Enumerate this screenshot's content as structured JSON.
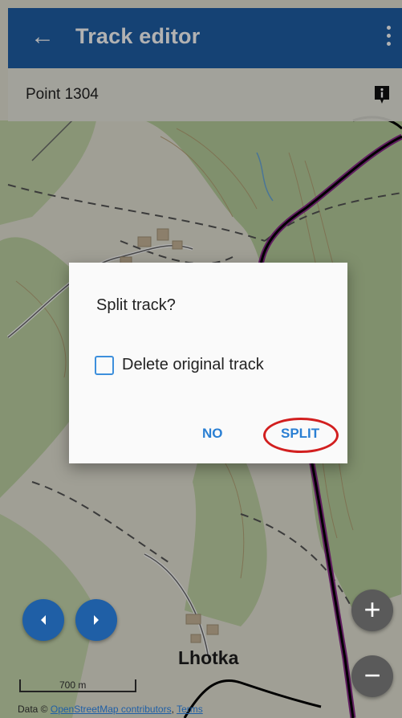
{
  "appbar": {
    "title": "Track editor",
    "back_icon": "arrow-left-icon",
    "menu_icon": "more-vert-icon"
  },
  "infobar": {
    "point_label": "Point 1304",
    "info_icon": "info-icon"
  },
  "dialog": {
    "title": "Split track?",
    "checkbox_label": "Delete original track",
    "checkbox_checked": false,
    "no_label": "NO",
    "split_label": "SPLIT"
  },
  "map": {
    "place_label": "Lhotka",
    "scale_label": "700 m",
    "attribution": {
      "prefix": "Data © ",
      "osm": "OpenStreetMap contributors",
      "sep": ", ",
      "terms": "Terms"
    }
  },
  "colors": {
    "appbar": "#1f5fa6",
    "accent": "#2a7fd3",
    "highlight_ring": "#d21f1f",
    "track": "#000000",
    "track_outline": "#8a2a8a"
  }
}
